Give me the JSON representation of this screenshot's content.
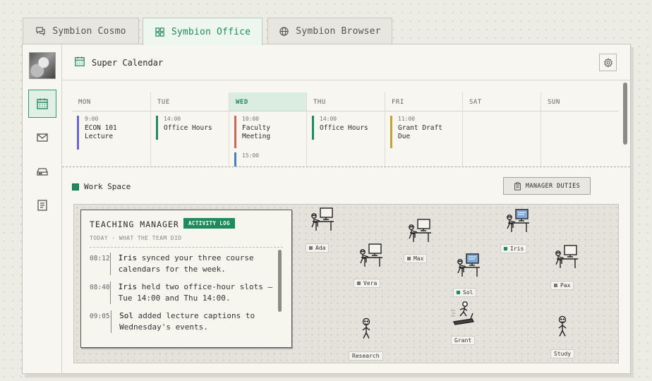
{
  "tabs": [
    {
      "label": "Symbion Cosmo",
      "icon": "chat-icon"
    },
    {
      "label": "Symbion Office",
      "icon": "grid-icon",
      "active": true
    },
    {
      "label": "Symbion Browser",
      "icon": "globe-icon"
    }
  ],
  "header": {
    "title": "Super Calendar"
  },
  "calendar": {
    "days": [
      {
        "label": "MON",
        "events": [
          {
            "time": "9:00",
            "title": "ECON 101 Lecture",
            "color": "#6b66c9"
          }
        ]
      },
      {
        "label": "TUE",
        "events": [
          {
            "time": "14:00",
            "title": "Office Hours",
            "color": "#1f8a5b"
          }
        ]
      },
      {
        "label": "WED",
        "today": true,
        "events": [
          {
            "time": "10:00",
            "title": "Faculty Meeting",
            "color": "#d0694f"
          },
          {
            "time": "15:00",
            "title": "",
            "color": "#4a7bc4"
          }
        ]
      },
      {
        "label": "THU",
        "events": [
          {
            "time": "14:00",
            "title": "Office Hours",
            "color": "#1f8a5b"
          }
        ]
      },
      {
        "label": "FRI",
        "events": [
          {
            "time": "11:00",
            "title": "Grant Draft Due",
            "color": "#c9a227"
          }
        ]
      },
      {
        "label": "SAT",
        "events": []
      },
      {
        "label": "SUN",
        "events": []
      }
    ]
  },
  "workspace": {
    "label": "Work Space",
    "manager_button": "MANAGER DUTIES",
    "agents": {
      "ada": "Ada",
      "vera": "Vera",
      "max": "Max",
      "iris": "Iris",
      "sol": "Sol",
      "pax": "Pax",
      "grant": "Grant",
      "research": "Research",
      "study": "Study"
    }
  },
  "log": {
    "title": "TEACHING MANAGER",
    "badge": "ACTIVITY LOG",
    "subtitle": "TODAY · WHAT THE TEAM DID",
    "entries": [
      {
        "time": "08:12",
        "name": "Iris",
        "text": " synced your three course calendars for the week."
      },
      {
        "time": "08:40",
        "name": "Iris",
        "text": " held two office-hour slots — Tue 14:00 and Thu 14:00."
      },
      {
        "time": "09:05",
        "name": "Sol",
        "text": " added lecture captions to Wednesday's events."
      }
    ]
  },
  "colors": {
    "accent": "#1f8a5b",
    "today_bg": "#dbece0"
  }
}
